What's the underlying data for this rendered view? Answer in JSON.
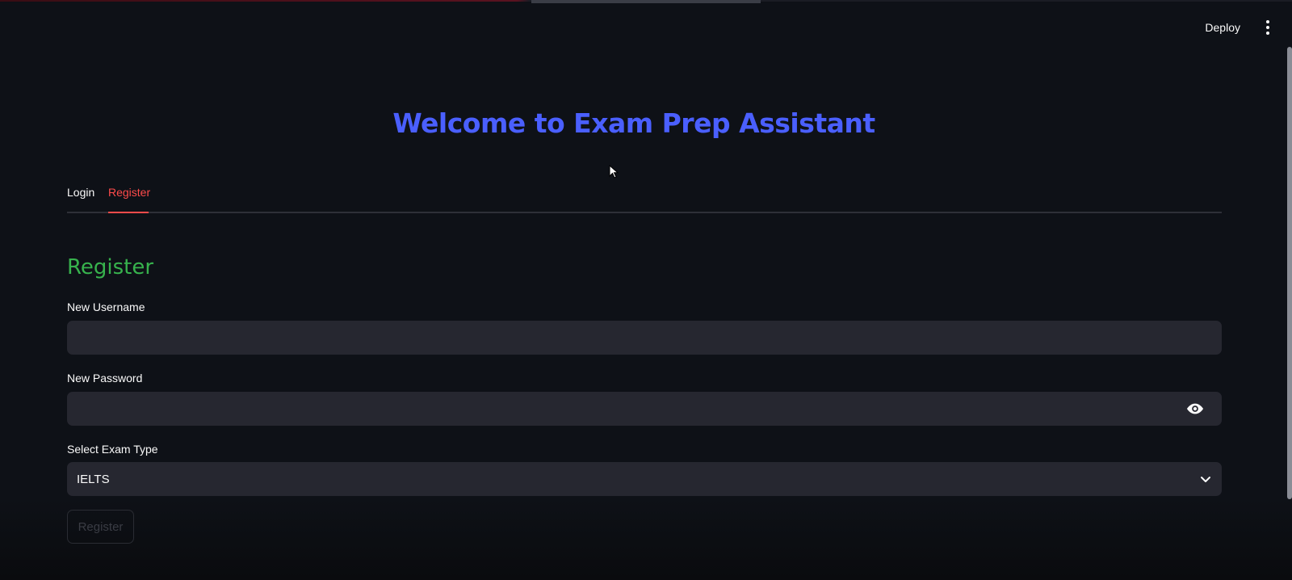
{
  "header": {
    "deploy_label": "Deploy",
    "menu_icon": "kebab-menu-icon"
  },
  "title": "Welcome to Exam Prep Assistant",
  "tabs": [
    {
      "label": "Login",
      "active": false
    },
    {
      "label": "Register",
      "active": true
    }
  ],
  "form": {
    "heading": "Register",
    "username_label": "New Username",
    "username_value": "",
    "password_label": "New Password",
    "password_value": "",
    "password_toggle_icon": "eye-icon",
    "exam_type_label": "Select Exam Type",
    "exam_type_value": "IELTS",
    "submit_label": "Register"
  },
  "colors": {
    "background": "#0e1117",
    "title": "#4a5fff",
    "active_tab": "#ff4b4b",
    "heading": "#37b24d",
    "input_bg": "#262730"
  }
}
